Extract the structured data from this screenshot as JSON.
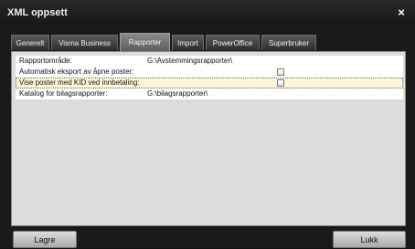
{
  "window": {
    "title": "XML oppsett",
    "close_label": "×"
  },
  "tabs": [
    {
      "label": "Generelt",
      "active": false
    },
    {
      "label": "Visma Business",
      "active": false
    },
    {
      "label": "Rapporter",
      "active": true
    },
    {
      "label": "Import",
      "active": false
    },
    {
      "label": "PowerOffice",
      "active": false
    },
    {
      "label": "Superbruker",
      "active": false
    }
  ],
  "settings": {
    "rows": [
      {
        "label": "Rapportområde:",
        "value": "G:\\Avstemmingsrapporter\\",
        "type": "text"
      },
      {
        "label": "Automatisk eksport av åpne poster:",
        "checked": false,
        "type": "checkbox"
      },
      {
        "label": "Vise poster med KID ved innbetaling:",
        "checked": false,
        "type": "checkbox",
        "selected": true
      },
      {
        "label": "Katalog for bilagsrapporter:",
        "value": "G:\\bilagsrapporter\\",
        "type": "text"
      }
    ]
  },
  "footer": {
    "save_label": "Lagre",
    "close_label": "Lukk"
  },
  "colors": {
    "titlebar": "#1e1e1e",
    "panel": "#dcdcdc",
    "selected_row": "#fdf6d8"
  }
}
